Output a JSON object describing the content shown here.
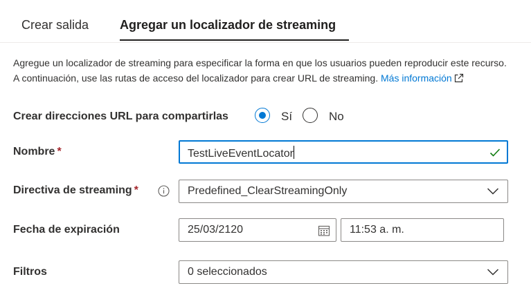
{
  "tabs": [
    {
      "label": "Crear salida"
    },
    {
      "label": "Agregar un localizador de streaming"
    }
  ],
  "description": {
    "text": "Agregue un localizador de streaming para especificar la forma en que los usuarios pueden reproducir este recurso. A continuación, use las rutas de acceso del localizador para crear URL de streaming.",
    "link": "Más información"
  },
  "share_urls": {
    "label": "Crear direcciones URL para compartirlas",
    "options": [
      {
        "label": "Sí",
        "selected": true
      },
      {
        "label": "No",
        "selected": false
      }
    ]
  },
  "form": {
    "name": {
      "label": "Nombre",
      "required": "*",
      "value": "TestLiveEventLocator"
    },
    "policy": {
      "label": "Directiva de streaming",
      "required": "*",
      "value": "Predefined_ClearStreamingOnly"
    },
    "expiration": {
      "label": "Fecha de expiración",
      "date": "25/03/2120",
      "time": "11:53 a. m."
    },
    "filters": {
      "label": "Filtros",
      "value": "0 seleccionados"
    }
  },
  "colors": {
    "accent": "#0078d4",
    "valid": "#107c10",
    "required": "#a4262c"
  },
  "icons": [
    "external-link-icon",
    "check-icon",
    "info-icon",
    "chevron-down-icon",
    "calendar-icon"
  ]
}
